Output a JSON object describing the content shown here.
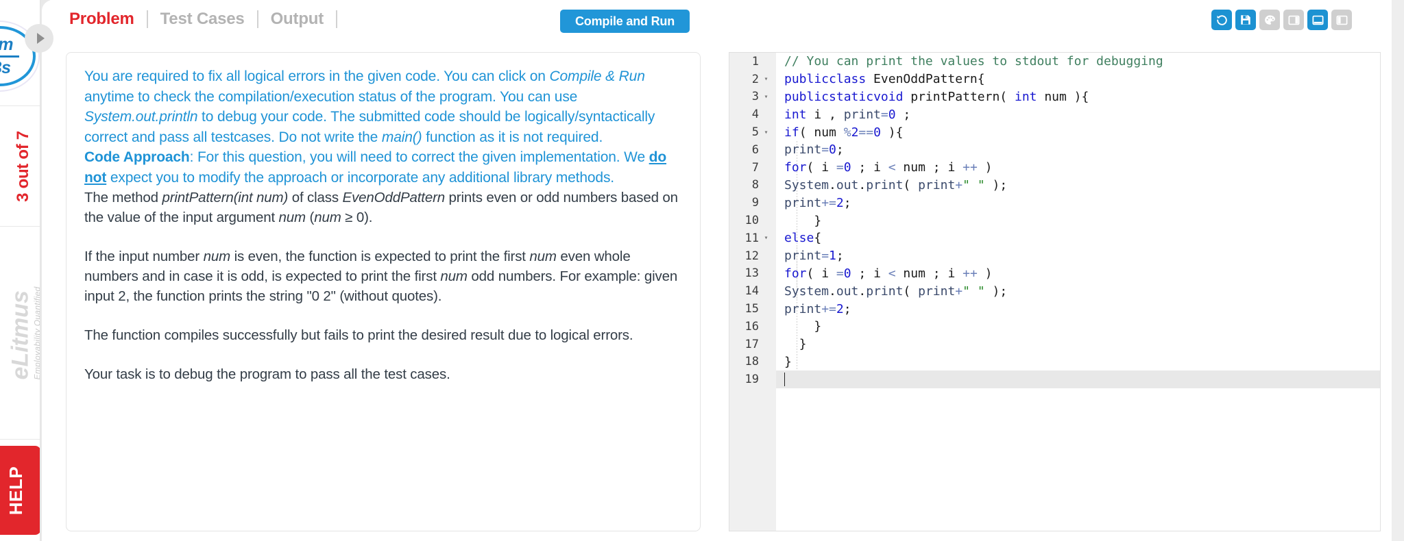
{
  "sidebar": {
    "logo": {
      "line1": "Vm",
      "line2": "Bs",
      "name": "brand-logo"
    },
    "progress_label": "3 out of 7",
    "watermark_big": "eLitmus",
    "watermark_small": "Employability Quantified",
    "help_label": "HELP"
  },
  "topbar": {
    "tabs": [
      {
        "label": "Problem",
        "active": true
      },
      {
        "label": "Test Cases",
        "active": false
      },
      {
        "label": "Output",
        "active": false
      }
    ],
    "run_button": "Compile and Run",
    "icons": [
      {
        "name": "reset-icon",
        "state": "blue"
      },
      {
        "name": "save-icon",
        "state": "blue"
      },
      {
        "name": "palette-icon",
        "state": "gray"
      },
      {
        "name": "layout-right-icon",
        "state": "gray"
      },
      {
        "name": "layout-bottom-icon",
        "state": "blue"
      },
      {
        "name": "layout-left-icon",
        "state": "gray"
      }
    ]
  },
  "problem": {
    "intro_p1_a": "You are required to fix all logical errors in the given code. You can click on ",
    "intro_p1_em1": "Compile & Run",
    "intro_p1_b": " anytime to check the compilation/execution status of the program. You can use ",
    "intro_p1_em2": "System.out.println",
    "intro_p1_c": " to debug your code. The submitted code should be logically/syntactically correct and pass all testcases. Do not write the ",
    "intro_p1_em3": "main()",
    "intro_p1_d": " function as it is not required.",
    "approach_label": "Code Approach",
    "approach_a": ": For this question, you will need to correct the given implementation. We ",
    "approach_u": "do not",
    "approach_b": " expect you to modify the approach or incorporate any additional library methods.",
    "body_p1_a": "The method ",
    "body_p1_em1": "printPattern(int num)",
    "body_p1_b": " of class ",
    "body_p1_em2": "EvenOddPattern",
    "body_p1_c": " prints even or odd numbers based on the value of the input argument ",
    "body_p1_em3": "num",
    "body_p1_d": " (",
    "body_p1_em4": "num",
    "body_p1_e": " ≥ 0).",
    "body_p2_a": "If the input number ",
    "body_p2_em1": "num",
    "body_p2_b": " is even, the function is expected to print the first ",
    "body_p2_em2": "num",
    "body_p2_c": " even whole numbers and in case it is odd, is expected to print the first ",
    "body_p2_em3": "num",
    "body_p2_d": " odd numbers. For example: given input 2, the function prints the string \"0 2\" (without quotes).",
    "body_p3": "The function compiles successfully but fails to print the desired result due to logical errors.",
    "body_p4": "Your task is to debug the program to pass all the test cases."
  },
  "editor": {
    "language": "java",
    "active_line": 19,
    "total_lines": 19,
    "lines": [
      {
        "n": 1,
        "fold": false
      },
      {
        "n": 2,
        "fold": true
      },
      {
        "n": 3,
        "fold": true
      },
      {
        "n": 4,
        "fold": false
      },
      {
        "n": 5,
        "fold": true
      },
      {
        "n": 6,
        "fold": false
      },
      {
        "n": 7,
        "fold": false
      },
      {
        "n": 8,
        "fold": false
      },
      {
        "n": 9,
        "fold": false
      },
      {
        "n": 10,
        "fold": false
      },
      {
        "n": 11,
        "fold": true
      },
      {
        "n": 12,
        "fold": false
      },
      {
        "n": 13,
        "fold": false
      },
      {
        "n": 14,
        "fold": false
      },
      {
        "n": 15,
        "fold": false
      },
      {
        "n": 16,
        "fold": false
      },
      {
        "n": 17,
        "fold": false
      },
      {
        "n": 18,
        "fold": false
      },
      {
        "n": 19,
        "fold": false
      }
    ],
    "code_text": [
      "// You can print the values to stdout for debugging",
      "public class EvenOddPattern{",
      "  public static void printPattern( int num ){",
      "    int i , print = 0 ;",
      "    if( num % 2 == 0 ){",
      "      print = 0;",
      "      for( i = 0 ; i < num ; i ++ )",
      "        System.out.print( print + \" \" );",
      "      print += 2;",
      "    }",
      "    else{",
      "      print = 1;",
      "      for( i = 0 ; i < num ; i ++ )",
      "        System.out.print( print + \" \" );",
      "      print += 2;",
      "    }",
      "  }",
      "}",
      ""
    ]
  },
  "colors": {
    "accent_blue": "#2196d8",
    "accent_red": "#e2262c",
    "text_blue": "#1f93d6",
    "text_dark": "#333d47",
    "keyword": "#1818d0",
    "comment": "#3f7f5f",
    "string": "#2a8a2a"
  }
}
